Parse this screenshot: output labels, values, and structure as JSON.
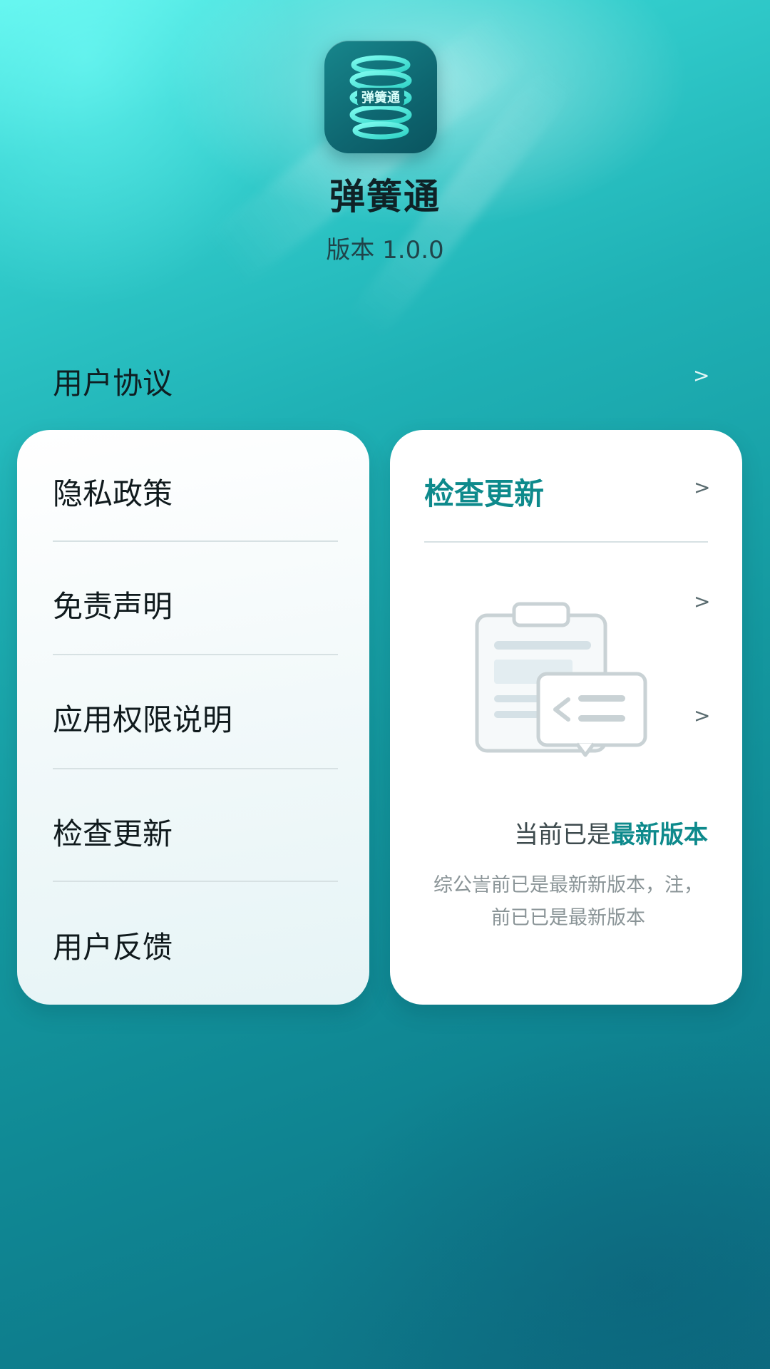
{
  "header": {
    "app_name": "弹簧通",
    "version_text": "版本 1.0.0",
    "icon": "spring-coil-icon",
    "icon_text": "弹簧通"
  },
  "agreement": {
    "label": "用户协议",
    "chevron": ">"
  },
  "left_menu": {
    "items": [
      {
        "label": "隐私政策"
      },
      {
        "label": "免责声明"
      },
      {
        "label": "应用权限说明"
      },
      {
        "label": "检查更新"
      },
      {
        "label": "用户反馈"
      }
    ]
  },
  "update_card": {
    "title": "检查更新",
    "chevron": ">",
    "illustration": "clipboard-message-icon",
    "status_prefix": "当前已是",
    "status_highlight": "最新版本",
    "note_line1": "综公訔前已是最新新版本，注，",
    "note_line2": "前已已是最新版本"
  },
  "colors": {
    "accent": "#0e8a8c",
    "background_top": "#5ff3ec",
    "background_bottom": "#0d6e82"
  }
}
